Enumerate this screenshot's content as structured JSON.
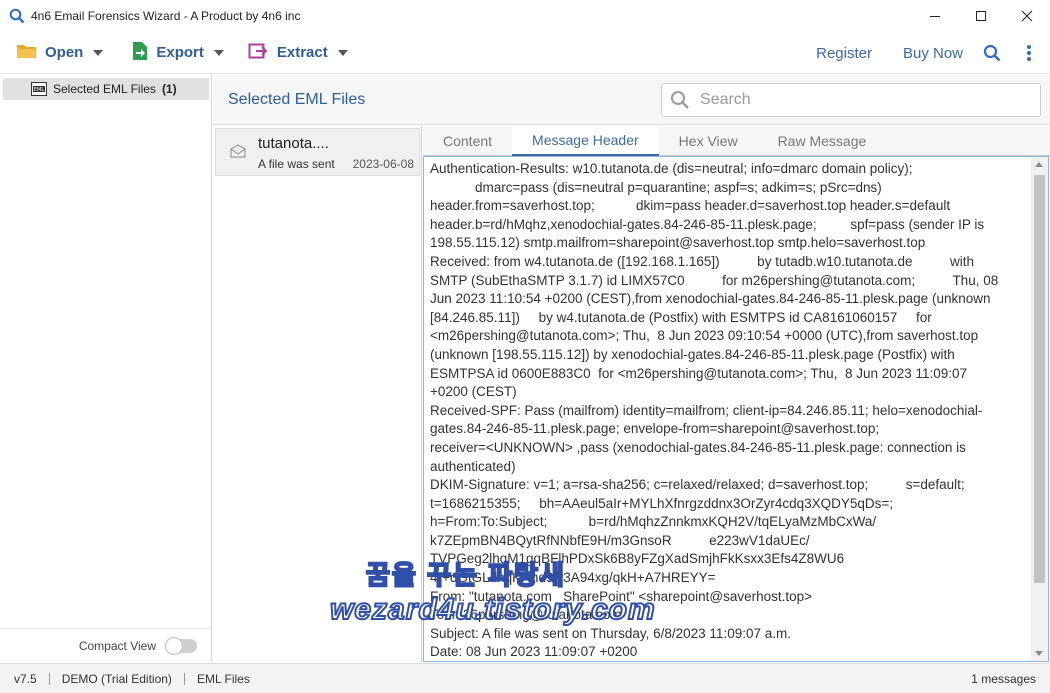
{
  "window": {
    "title": "4n6 Email Forensics Wizard - A Product by 4n6 inc",
    "controls": [
      "minimize-icon",
      "maximize-icon",
      "close-icon"
    ]
  },
  "toolbar": {
    "open_label": "Open",
    "export_label": "Export",
    "extract_label": "Extract",
    "register_label": "Register",
    "buynow_label": "Buy Now",
    "icons": [
      "folder-icon",
      "export-icon",
      "extract-icon",
      "search-icon",
      "more-vertical-icon"
    ]
  },
  "sidebar": {
    "item_label": "Selected EML Files",
    "item_count": "(1)",
    "compact_label": "Compact View",
    "compact_on": false
  },
  "main": {
    "section_title": "Selected EML Files",
    "search_placeholder": "Search"
  },
  "messages": [
    {
      "sender": "tutanota....",
      "subject": "A file was sent",
      "date": "2023-06-08"
    }
  ],
  "tabs": [
    {
      "label": "Content",
      "active": false
    },
    {
      "label": "Message Header",
      "active": true
    },
    {
      "label": "Hex View",
      "active": false
    },
    {
      "label": "Raw Message",
      "active": false
    }
  ],
  "header_text": "Authentication-Results: w10.tutanota.de (dis=neutral; info=dmarc domain policy);\n            dmarc=pass (dis=neutral p=quarantine; aspf=s; adkim=s; pSrc=dns)\nheader.from=saverhost.top;           dkim=pass header.d=saverhost.top header.s=default\nheader.b=rd/hMqhz,xenodochial-gates.84-246-85-11.plesk.page;         spf=pass (sender IP is\n198.55.115.12) smtp.mailfrom=sharepoint@saverhost.top smtp.helo=saverhost.top\nReceived: from w4.tutanota.de ([192.168.1.165])          by tutadb.w10.tutanota.de          with\nSMTP (SubEthaSMTP 3.1.7) id LIMX57C0          for m26pershing@tutanota.com;          Thu, 08\nJun 2023 11:10:54 +0200 (CEST),from xenodochial-gates.84-246-85-11.plesk.page (unknown\n[84.246.85.11])     by w4.tutanota.de (Postfix) with ESMTPS id CA8161060157     for\n<m26pershing@tutanota.com>; Thu,  8 Jun 2023 09:10:54 +0000 (UTC),from saverhost.top\n(unknown [198.55.115.12]) by xenodochial-gates.84-246-85-11.plesk.page (Postfix) with\nESMTPSA id 0600E883C0  for <m26pershing@tutanota.com>; Thu,  8 Jun 2023 11:09:07\n+0200 (CEST)\nReceived-SPF: Pass (mailfrom) identity=mailfrom; client-ip=84.246.85.11; helo=xenodochial-\ngates.84-246-85-11.plesk.page; envelope-from=sharepoint@saverhost.top;\nreceiver=<UNKNOWN> ,pass (xenodochial-gates.84-246-85-11.plesk.page: connection is\nauthenticated)\nDKIM-Signature: v=1; a=rsa-sha256; c=relaxed/relaxed; d=saverhost.top;          s=default;\nt=1686215355;     bh=AAeul5aIr+MYLhXfnrgzddnx3OrZyr4cdq3XQDY5qDs=;\nh=From:To:Subject;           b=rd/hMqhzZnnkmxKQH2V/tqELyaMzMbCxWa/\nk7ZEpmBN4BQytRfNNbfE9H/m3GnsoR          e223wV1daUEc/\nTVPGeg2lhgM1gqBFlhPDxSk6B8yFZgXadSmjhFkKsxx3Efs4Z8WU6\n4r+dGtGLdnqKRnd9w3A94xg/qkH+A7HREYY=\nFrom: \"tutanota.com _SharePoint\" <sharepoint@saverhost.top>\nTo: m26pershing@tutanota.com\nSubject: A file was sent on Thursday, 6/8/2023 11:09:07 a.m.\nDate: 08 Jun 2023 11:09:07 +0200",
  "watermark": {
    "line1": "꿈을 꾸는 파랑새",
    "line2": "wezard4u.tistory.com"
  },
  "status": {
    "version": "v7.5",
    "edition": "DEMO (Trial Edition)",
    "filetype": "EML Files",
    "count": "1 messages"
  },
  "colors": {
    "accent": "#2e5f99",
    "link": "#3b6aa5",
    "export_green": "#2e9e4f",
    "extract_magenta": "#b23b9a",
    "open_yellow": "#e6a92a"
  }
}
